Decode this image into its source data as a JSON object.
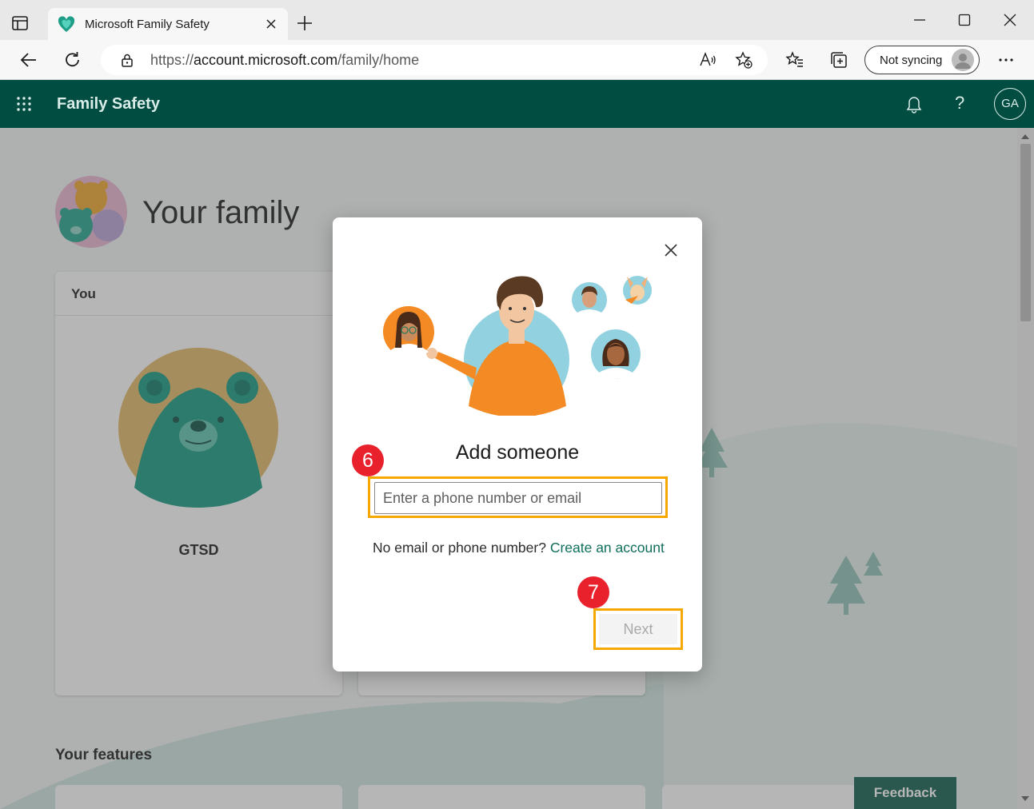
{
  "browser": {
    "tab_title": "Microsoft Family Safety",
    "url_prefix": "https://",
    "url_host": "account.microsoft.com",
    "url_path": "/family/home",
    "sync_label": "Not syncing"
  },
  "site": {
    "brand": "Family Safety",
    "help": "?",
    "user_initials": "GA",
    "accent": "#024d42"
  },
  "page": {
    "title": "Your family",
    "you_card_header": "You",
    "user_name": "GTSD",
    "features_heading": "Your features",
    "feedback_label": "Feedback"
  },
  "dialog": {
    "title": "Add someone",
    "input_placeholder": "Enter a phone number or email",
    "note_text": "No email or phone number?",
    "create_link": "Create an account",
    "next_label": "Next"
  },
  "annotations": {
    "step_input": "6",
    "step_next": "7",
    "highlight_color": "#f5a800",
    "badge_color": "#e8212c"
  }
}
